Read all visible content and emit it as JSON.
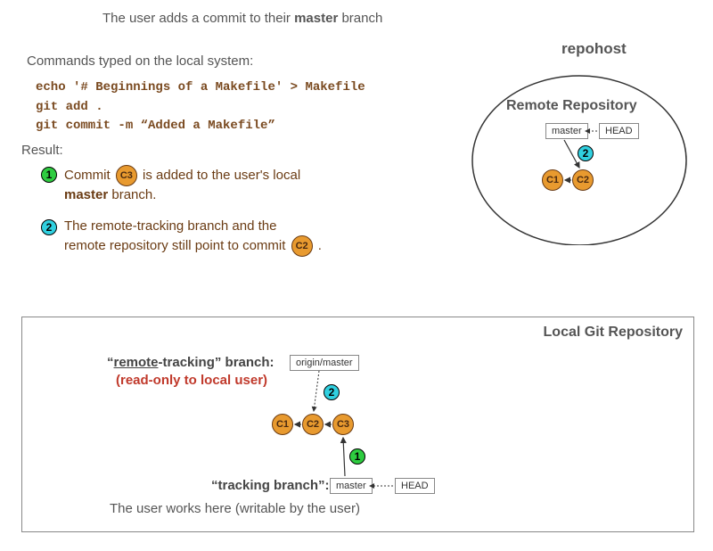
{
  "title_pre": "The user adds a commit to their ",
  "title_bold": "master",
  "title_post": " branch",
  "commands_label": "Commands typed on the local system:",
  "cmd1": "echo '# Beginnings of a Makefile' > Makefile",
  "cmd2": "git add .",
  "cmd3": "git commit -m “Added a Makefile”",
  "result_label": "Result:",
  "r1": {
    "num": "1",
    "pre": "Commit ",
    "commit": "C3",
    "mid": " is added to the user's local ",
    "bold": "master",
    "post": " branch."
  },
  "r2": {
    "num": "2",
    "line1": "The remote-tracking branch and the",
    "line2a": "remote repository still point to commit ",
    "commit": "C2",
    "line2b": " ."
  },
  "remote": {
    "host": "repohost",
    "heading": "Remote Repository",
    "master": "master",
    "head": "HEAD",
    "step": "2",
    "c1": "C1",
    "c2": "C2"
  },
  "local": {
    "title": "Local Git Repository",
    "rt_pre": "“",
    "rt_under": "remote",
    "rt_post": "-tracking” branch:",
    "rt_sub": "(read-only to local user)",
    "origin_master": "origin/master",
    "step_top": "2",
    "c1": "C1",
    "c2": "C2",
    "c3": "C3",
    "step_bottom": "1",
    "track_label": "“tracking branch”:",
    "master": "master",
    "head": "HEAD",
    "track_sub": "The user works here (writable by the user)"
  }
}
